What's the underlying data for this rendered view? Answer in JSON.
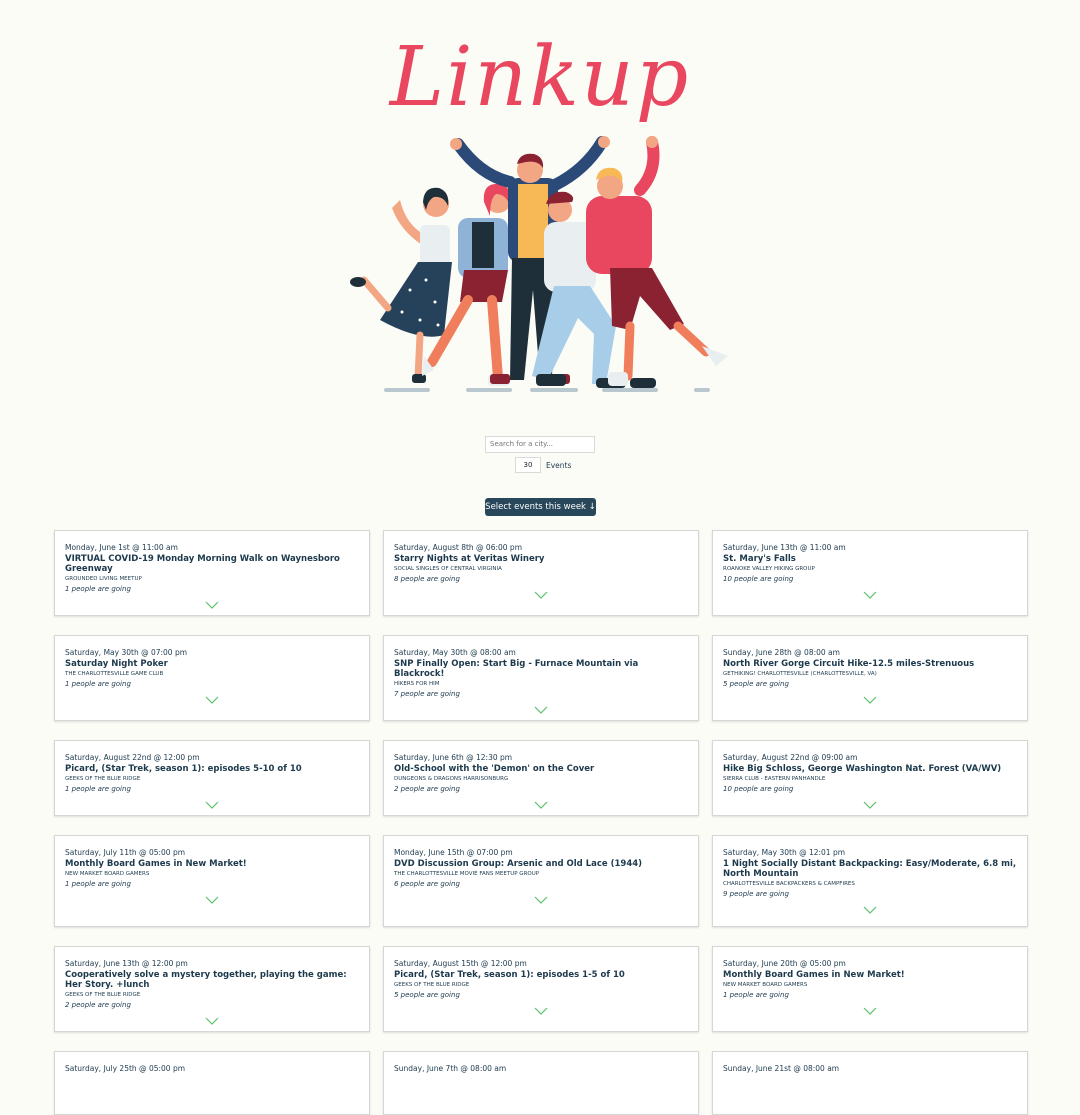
{
  "app": {
    "logo_text": "Linkup"
  },
  "search": {
    "placeholder": "Search for a city..."
  },
  "events_count": {
    "value": "30",
    "label": "Events"
  },
  "week_button": {
    "label": "Select events this week ↓"
  },
  "colors": {
    "logo": "#e8475f",
    "button": "#28475a",
    "chevron": "#5cc06e",
    "background": "#fcfcf7"
  },
  "icons": {
    "expand": "chevron-down-icon"
  },
  "events": [
    {
      "date": "Monday, June 1st @ 11:00 am",
      "title": "VIRTUAL COVID-19 Monday Morning Walk on Waynesboro Greenway",
      "group": "GROUNDED LIVING MEETUP",
      "going": "1 people are going"
    },
    {
      "date": "Saturday, August 8th @ 06:00 pm",
      "title": "Starry Nights at Veritas Winery",
      "group": "SOCIAL SINGLES OF CENTRAL VIRGINIA",
      "going": "8 people are going"
    },
    {
      "date": "Saturday, June 13th @ 11:00 am",
      "title": "St. Mary's Falls",
      "group": "ROANOKE VALLEY HIKING GROUP",
      "going": "10 people are going"
    },
    {
      "date": "Saturday, May 30th @ 07:00 pm",
      "title": "Saturday Night Poker",
      "group": "THE CHARLOTTESVILLE GAME CLUB",
      "going": "1 people are going"
    },
    {
      "date": "Saturday, May 30th @ 08:00 am",
      "title": "SNP Finally Open: Start Big - Furnace Mountain via Blackrock!",
      "group": "HIKERS FOR HIM",
      "going": "7 people are going"
    },
    {
      "date": "Sunday, June 28th @ 08:00 am",
      "title": "North River Gorge Circuit Hike-12.5 miles-Strenuous",
      "group": "GETHIKING! CHARLOTTESVILLE (CHARLOTTESVILLE, VA)",
      "going": "5 people are going"
    },
    {
      "date": "Saturday, August 22nd @ 12:00 pm",
      "title": "Picard, (Star Trek, season 1): episodes 5-10 of 10",
      "group": "GEEKS OF THE BLUE RIDGE",
      "going": "1 people are going"
    },
    {
      "date": "Saturday, June 6th @ 12:30 pm",
      "title": "Old-School with the 'Demon' on the Cover",
      "group": "DUNGEONS & DRAGONS HARRISONBURG",
      "going": "2 people are going"
    },
    {
      "date": "Saturday, August 22nd @ 09:00 am",
      "title": "Hike Big Schloss, George Washington Nat. Forest (VA/WV)",
      "group": "SIERRA CLUB - EASTERN PANHANDLE",
      "going": "10 people are going"
    },
    {
      "date": "Saturday, July 11th @ 05:00 pm",
      "title": "Monthly Board Games in New Market!",
      "group": "NEW MARKET BOARD GAMERS",
      "going": "1 people are going"
    },
    {
      "date": "Monday, June 15th @ 07:00 pm",
      "title": "DVD Discussion Group: Arsenic and Old Lace (1944)",
      "group": "THE CHARLOTTESVILLE MOVIE FANS MEETUP GROUP",
      "going": "6 people are going"
    },
    {
      "date": "Saturday, May 30th @ 12:01 pm",
      "title": "1 Night Socially Distant Backpacking: Easy/Moderate, 6.8 mi, North Mountain",
      "group": "CHARLOTTESVILLE BACKPACKERS & CAMPFIRES",
      "going": "9 people are going"
    },
    {
      "date": "Saturday, June 13th @ 12:00 pm",
      "title": "Cooperatively solve a mystery together, playing the game: Her Story. +lunch",
      "group": "GEEKS OF THE BLUE RIDGE",
      "going": "2 people are going"
    },
    {
      "date": "Saturday, August 15th @ 12:00 pm",
      "title": "Picard, (Star Trek, season 1): episodes 1-5 of 10",
      "group": "GEEKS OF THE BLUE RIDGE",
      "going": "5 people are going"
    },
    {
      "date": "Saturday, June 20th @ 05:00 pm",
      "title": "Monthly Board Games in New Market!",
      "group": "NEW MARKET BOARD GAMERS",
      "going": "1 people are going"
    },
    {
      "date": "Saturday, July 25th @ 05:00 pm",
      "title": "",
      "group": "",
      "going": ""
    },
    {
      "date": "Sunday, June 7th @ 08:00 am",
      "title": "",
      "group": "",
      "going": ""
    },
    {
      "date": "Sunday, June 21st @ 08:00 am",
      "title": "",
      "group": "",
      "going": ""
    }
  ]
}
